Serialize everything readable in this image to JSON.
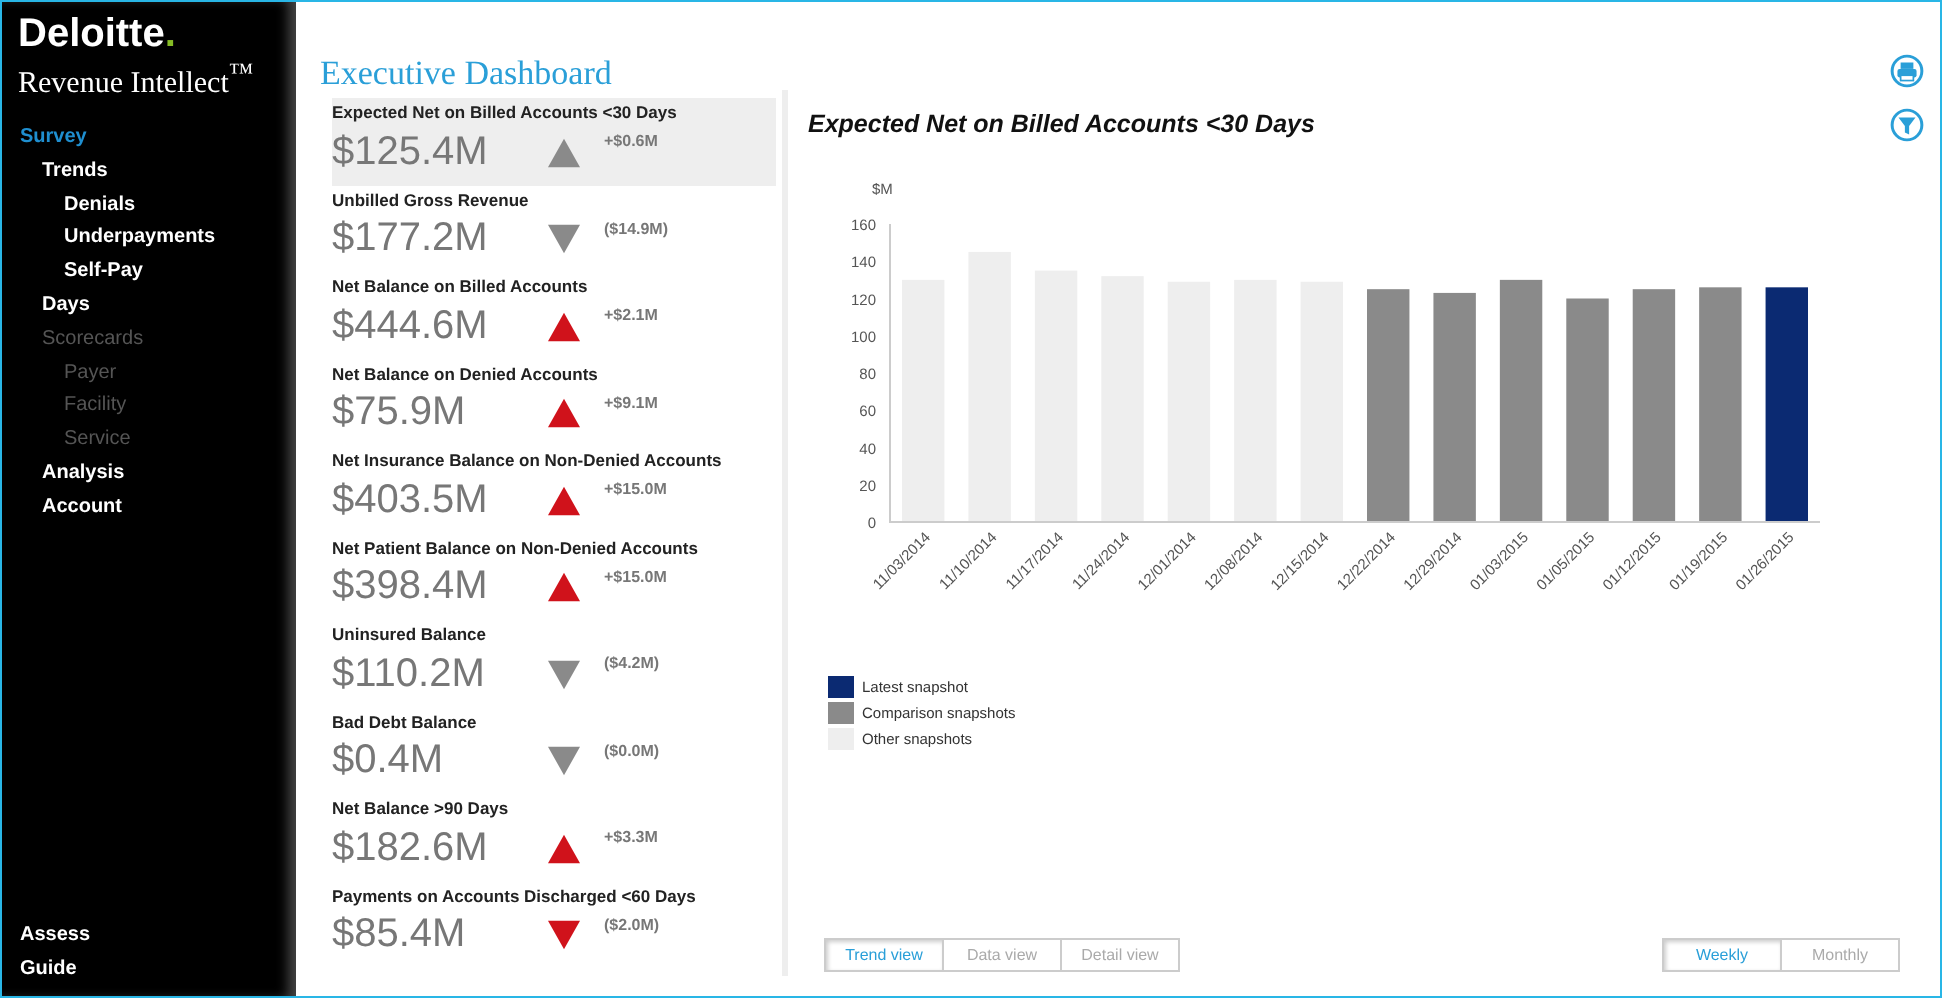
{
  "sidebar": {
    "brand": "Deloitte",
    "brand_dot": ".",
    "product": "Revenue Intellect$^{™}$",
    "nav": [
      {
        "label": "Survey",
        "selected": true,
        "disabled": false,
        "children": [
          {
            "label": "Trends",
            "selected": false,
            "disabled": false,
            "children": [
              {
                "label": "Denials",
                "selected": false,
                "disabled": false
              },
              {
                "label": "Underpayments",
                "selected": false,
                "disabled": false
              },
              {
                "label": "Self-Pay",
                "selected": false,
                "disabled": false
              }
            ]
          },
          {
            "label": "Days",
            "selected": false,
            "disabled": false
          },
          {
            "label": "Scorecards",
            "selected": false,
            "disabled": true,
            "children": [
              {
                "label": "Payer",
                "selected": false,
                "disabled": true
              },
              {
                "label": "Facility",
                "selected": false,
                "disabled": true
              },
              {
                "label": "Service",
                "selected": false,
                "disabled": true
              }
            ]
          },
          {
            "label": "Analysis",
            "selected": false,
            "disabled": false
          },
          {
            "label": "Account",
            "selected": false,
            "disabled": false
          }
        ]
      }
    ],
    "bottom": [
      {
        "label": "Assess",
        "selected": false
      },
      {
        "label": "Guide",
        "selected": false
      }
    ]
  },
  "page_title": "Executive Dashboard",
  "metrics": [
    {
      "title": "Expected Net on Billed Accounts <30 Days",
      "value": "$125.4M",
      "kind": "up",
      "color": "#8a8a8a",
      "change": "+$0.6M",
      "selected": true
    },
    {
      "title": "Unbilled Gross Revenue",
      "value": "$177.2M",
      "kind": "down",
      "color": "#8a8a8a",
      "change": "($14.9M)",
      "selected": false
    },
    {
      "title": "Net Balance on Billed Accounts",
      "value": "$444.6M",
      "kind": "up",
      "color": "#d0121b",
      "change": "+$2.1M",
      "selected": false
    },
    {
      "title": "Net Balance on Denied Accounts",
      "value": "$75.9M",
      "kind": "up",
      "color": "#d0121b",
      "change": "+$9.1M",
      "selected": false
    },
    {
      "title": "Net Insurance Balance on Non-Denied Accounts",
      "value": "$403.5M",
      "kind": "up",
      "color": "#d0121b",
      "change": "+$15.0M",
      "selected": false
    },
    {
      "title": "Net Patient Balance on Non-Denied Accounts",
      "value": "$398.4M",
      "kind": "up",
      "color": "#d0121b",
      "change": "+$15.0M",
      "selected": false
    },
    {
      "title": "Uninsured Balance",
      "value": "$110.2M",
      "kind": "down",
      "color": "#8a8a8a",
      "change": "($4.2M)",
      "selected": false
    },
    {
      "title": "Bad Debt Balance",
      "value": "$0.4M",
      "kind": "down",
      "color": "#8a8a8a",
      "change": "($0.0M)",
      "selected": false
    },
    {
      "title": "Net Balance >90 Days",
      "value": "$182.6M",
      "kind": "up",
      "color": "#d0121b",
      "change": "+$3.3M",
      "selected": false
    },
    {
      "title": "Payments on Accounts Discharged <60 Days",
      "value": "$85.4M",
      "kind": "down",
      "color": "#d0121b",
      "change": "($2.0M)",
      "selected": false
    }
  ],
  "chart_panel": {
    "chart_data": {
      "type": "bar",
      "legend": "bottom-left",
      "title": "Expected Net on Billed Accounts <30 Days",
      "ylabel": "$M",
      "stacked": true,
      "categories": [
        "11/03/2014",
        "11/10/2014",
        "11/17/2014",
        "11/24/2014",
        "12/01/2014",
        "12/08/2014",
        "12/15/2014",
        "12/22/2014",
        "12/29/2014",
        "01/03/2015",
        "01/05/2015",
        "01/12/2015",
        "01/19/2015",
        "01/26/2015"
      ],
      "ylim": [
        0,
        160
      ],
      "yticks": [
        0,
        20,
        40,
        60,
        80,
        100,
        120,
        140,
        160
      ],
      "series": [
        {
          "name": "Latest snapshot",
          "color": "#0b2a72",
          "values": [
            null,
            null,
            null,
            null,
            null,
            null,
            null,
            null,
            null,
            null,
            null,
            null,
            null,
            126
          ]
        },
        {
          "name": "Comparison snapshots",
          "color": "#8a8a8a",
          "values": [
            null,
            null,
            null,
            null,
            null,
            null,
            null,
            125,
            123,
            130,
            120,
            125,
            126,
            null
          ]
        },
        {
          "name": "Other snapshots",
          "color": "#eeeeee",
          "values": [
            130,
            145,
            135,
            132,
            129,
            130,
            129,
            null,
            null,
            null,
            null,
            null,
            null,
            null
          ]
        }
      ]
    },
    "views": [
      {
        "label": "Trend view",
        "selected": true
      },
      {
        "label": "Data view",
        "selected": false
      },
      {
        "label": "Detail view",
        "selected": false
      }
    ],
    "periods": [
      {
        "label": "Weekly",
        "selected": true
      },
      {
        "label": "Monthly",
        "selected": false
      }
    ]
  }
}
